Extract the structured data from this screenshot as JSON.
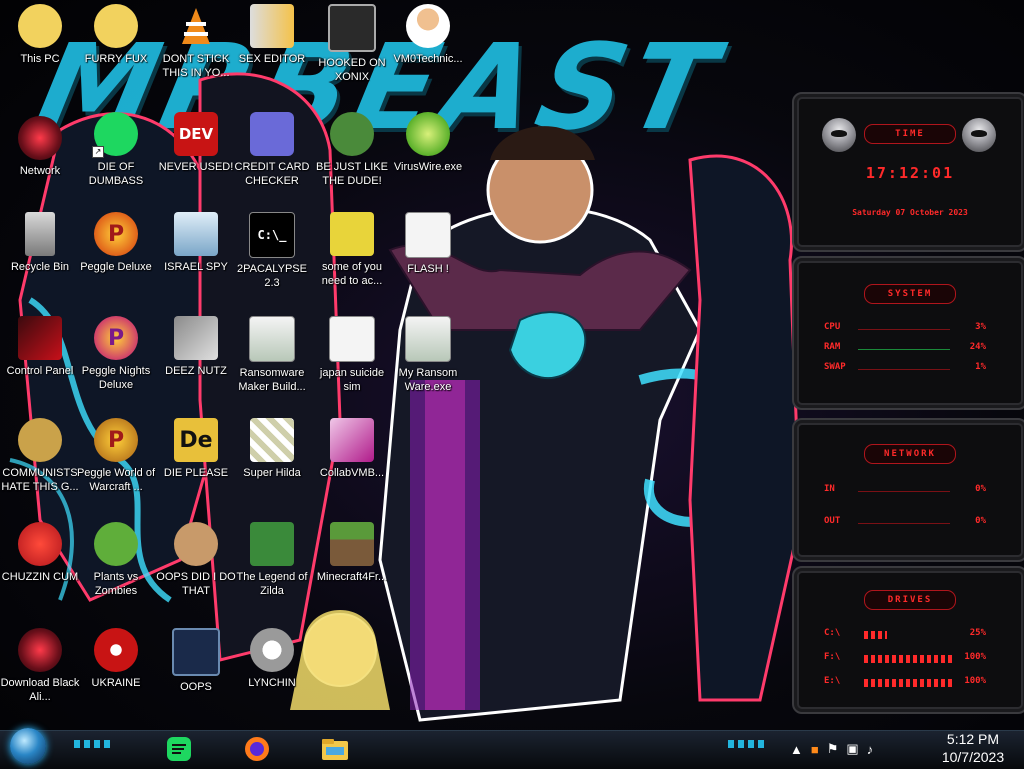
{
  "wallpaper": {
    "title_text": "MRBEAST"
  },
  "icons": [
    {
      "label": "This PC"
    },
    {
      "label": "FURRY FUX"
    },
    {
      "label": "DONT STICK THIS IN YO..."
    },
    {
      "label": "SEX EDITOR"
    },
    {
      "label": "HOOKED ON XONIX"
    },
    {
      "label": "VM0Technic..."
    },
    {
      "label": "Network"
    },
    {
      "label": "DIE OF DUMBASS"
    },
    {
      "label": "NEVER USED!"
    },
    {
      "label": "CREDIT CARD CHECKER"
    },
    {
      "label": "BE JUST LIKE THE DUDE!"
    },
    {
      "label": "VirusWire.exe"
    },
    {
      "label": "Recycle Bin"
    },
    {
      "label": "Peggle Deluxe"
    },
    {
      "label": "ISRAEL SPY"
    },
    {
      "label": "2PACALYPSE 2.3"
    },
    {
      "label": "some of you need to ac..."
    },
    {
      "label": "FLASH !"
    },
    {
      "label": "Control Panel"
    },
    {
      "label": "Peggle Nights Deluxe"
    },
    {
      "label": "DEEZ NUTZ"
    },
    {
      "label": "Ransomware Maker Build..."
    },
    {
      "label": "japan suicide sim"
    },
    {
      "label": "My Ransom Ware.exe"
    },
    {
      "label": "COMMUNISTS HATE THIS G..."
    },
    {
      "label": "Peggle World of Warcraft ..."
    },
    {
      "label": "DIE PLEASE"
    },
    {
      "label": "Super Hilda"
    },
    {
      "label": "CollabVMB..."
    },
    {
      "label": "CHUZZIN CUM"
    },
    {
      "label": "Plants vs Zombies"
    },
    {
      "label": "OOPS DID I DO THAT"
    },
    {
      "label": "The Legend of Zilda"
    },
    {
      "label": "Minecraft4Fr..."
    },
    {
      "label": "Download Black Ali..."
    },
    {
      "label": "UKRAINE"
    },
    {
      "label": "OOPS"
    },
    {
      "label": "LYNCHIN"
    }
  ],
  "icon_glyphs": {
    "dev_text": "DEV",
    "de_text": "De",
    "cmd_text": "C:\\_",
    "peggle_letter": "P"
  },
  "widgets": {
    "time": {
      "header": "TIME",
      "clock": "17:12:01",
      "date": "Saturday 07 October 2023"
    },
    "system": {
      "header": "SYSTEM",
      "rows": [
        {
          "key": "CPU",
          "value": "3%"
        },
        {
          "key": "RAM",
          "value": "24%"
        },
        {
          "key": "SWAP",
          "value": "1%"
        }
      ]
    },
    "network": {
      "header": "NETWORK",
      "rows": [
        {
          "key": "IN",
          "value": "0%"
        },
        {
          "key": "OUT",
          "value": "0%"
        }
      ]
    },
    "drives": {
      "header": "DRIVES",
      "rows": [
        {
          "key": "C:\\",
          "value": "25%"
        },
        {
          "key": "F:\\",
          "value": "100%"
        },
        {
          "key": "E:\\",
          "value": "100%"
        }
      ]
    }
  },
  "taskbar": {
    "clock_time": "5:12 PM",
    "clock_date": "10/7/2023"
  },
  "colors": {
    "accent_red": "#ff2a2a",
    "accent_cyan": "#25d0ff"
  }
}
